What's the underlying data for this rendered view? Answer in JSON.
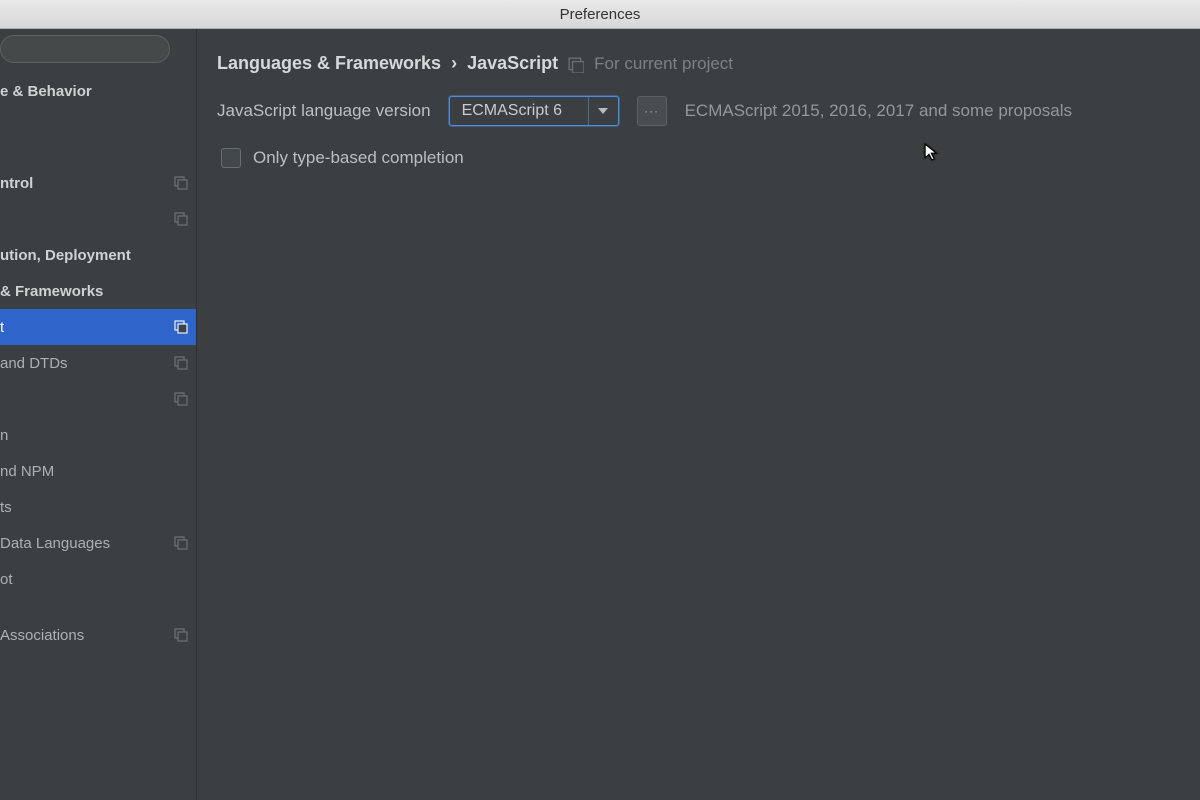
{
  "window": {
    "title": "Preferences"
  },
  "sidebar": {
    "search_placeholder": "",
    "items": [
      {
        "label": "e & Behavior",
        "top": true,
        "proj": false,
        "selected": false
      },
      {
        "label": "",
        "top": true,
        "proj": false,
        "selected": false,
        "spacer_after": true
      },
      {
        "label": "ntrol",
        "top": true,
        "proj": true,
        "selected": false
      },
      {
        "label": "",
        "top": true,
        "proj": true,
        "selected": false
      },
      {
        "label": "ution, Deployment",
        "top": true,
        "proj": false,
        "selected": false
      },
      {
        "label": " & Frameworks",
        "top": true,
        "proj": false,
        "selected": false
      },
      {
        "label": "t",
        "top": false,
        "proj": true,
        "selected": true
      },
      {
        "label": " and DTDs",
        "top": false,
        "proj": true,
        "selected": false
      },
      {
        "label": "",
        "top": false,
        "proj": true,
        "selected": false
      },
      {
        "label": "n",
        "top": false,
        "proj": false,
        "selected": false
      },
      {
        "label": "nd NPM",
        "top": false,
        "proj": false,
        "selected": false
      },
      {
        "label": "ts",
        "top": false,
        "proj": false,
        "selected": false
      },
      {
        "label": " Data Languages",
        "top": false,
        "proj": true,
        "selected": false
      },
      {
        "label": "ot",
        "top": false,
        "proj": false,
        "selected": false,
        "spacer_after": true
      },
      {
        "label": " Associations",
        "top": false,
        "proj": true,
        "selected": false
      }
    ]
  },
  "breadcrumb": {
    "parent": "Languages & Frameworks",
    "current": "JavaScript",
    "scope": "For current project"
  },
  "main": {
    "version_label": "JavaScript language version",
    "version_value": "ECMAScript 6",
    "version_hint": "ECMAScript 2015, 2016, 2017 and some proposals",
    "completion_label": "Only type-based completion",
    "completion_checked": false
  }
}
